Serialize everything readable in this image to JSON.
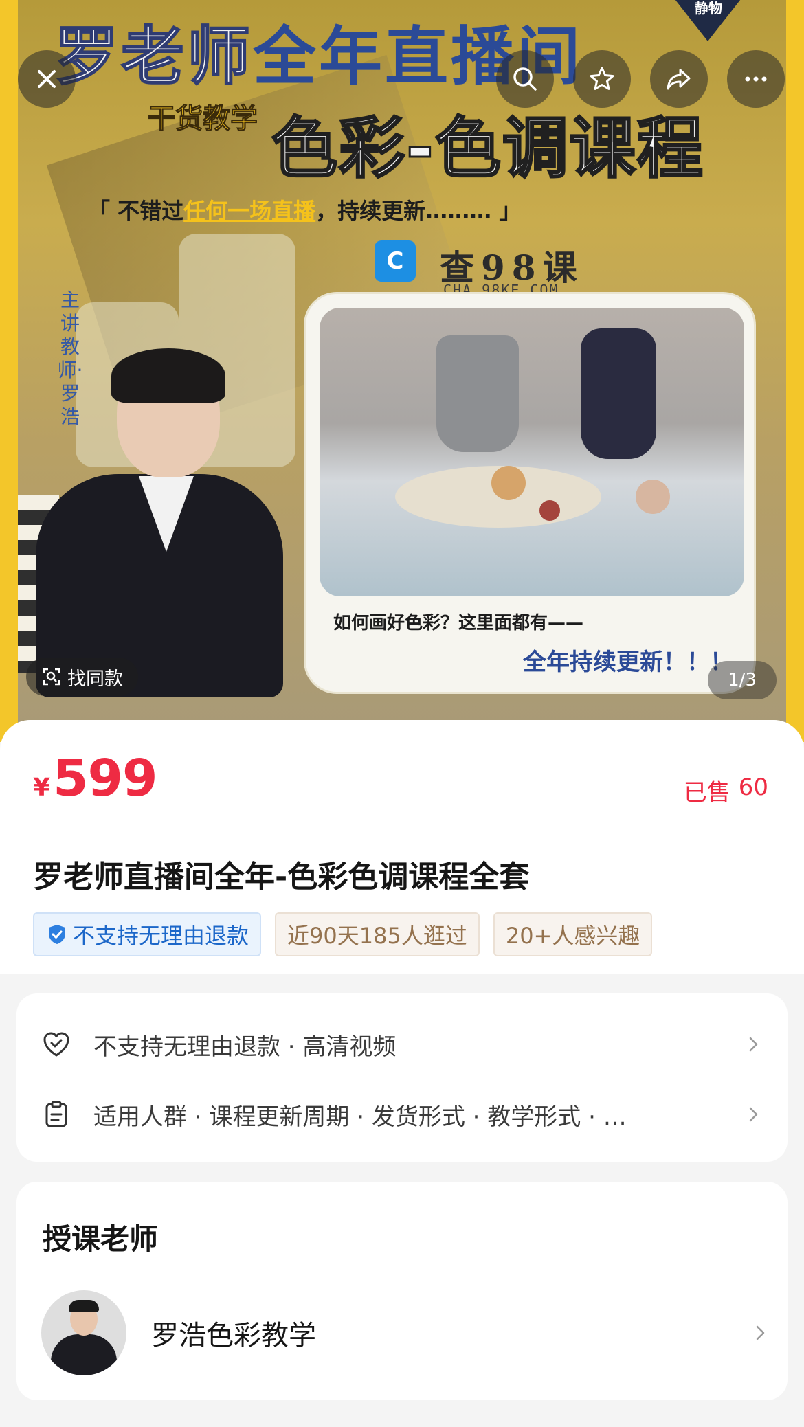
{
  "hero": {
    "title_prefix": "罗老师",
    "title_highlight": "全年直播间",
    "badge": "静物",
    "sub_small": "干货教学",
    "title_main": "色彩-色调课程",
    "quote_open": "「 不错过",
    "quote_highlight": "任何一场直播",
    "quote_rest": "，持续更新……… 」",
    "logo_glyph": "C",
    "logo_text": "查98课",
    "logo_url": "CHA.98KE.COM",
    "teacher_label": "主讲教师·罗浩",
    "card_caption": "如何画好色彩？这里面都有——",
    "card_slogan": "全年持续更新！！！",
    "find_similar": "找同款",
    "page_indicator": "1/3"
  },
  "controls": {
    "close_icon": "close-icon",
    "search_icon": "search-icon",
    "star_icon": "star-icon",
    "share_icon": "share-icon",
    "more_icon": "more-icon"
  },
  "product": {
    "currency": "¥",
    "price": "599",
    "sold_label": "已售",
    "sold_count": "60",
    "title": "罗老师直播间全年-色彩色调课程全套",
    "tags": [
      {
        "label": "不支持无理由退款",
        "style": "blue"
      },
      {
        "label": "近90天185人逛过",
        "style": "beige"
      },
      {
        "label": "20+人感兴趣",
        "style": "beige"
      }
    ]
  },
  "services": [
    {
      "icon": "heart-shield-icon",
      "text": "不支持无理由退款 · 高清视频"
    },
    {
      "icon": "clipboard-icon",
      "text": "适用人群 · 课程更新周期 · 发货形式 · 教学形式 · …"
    }
  ],
  "teacher_section": {
    "heading": "授课老师",
    "name": "罗浩色彩教学"
  },
  "colors": {
    "price_red": "#ee2b43",
    "tag_blue": "#1c67c9",
    "tag_beige": "#94724e",
    "frame_yellow": "#f3c62a"
  }
}
